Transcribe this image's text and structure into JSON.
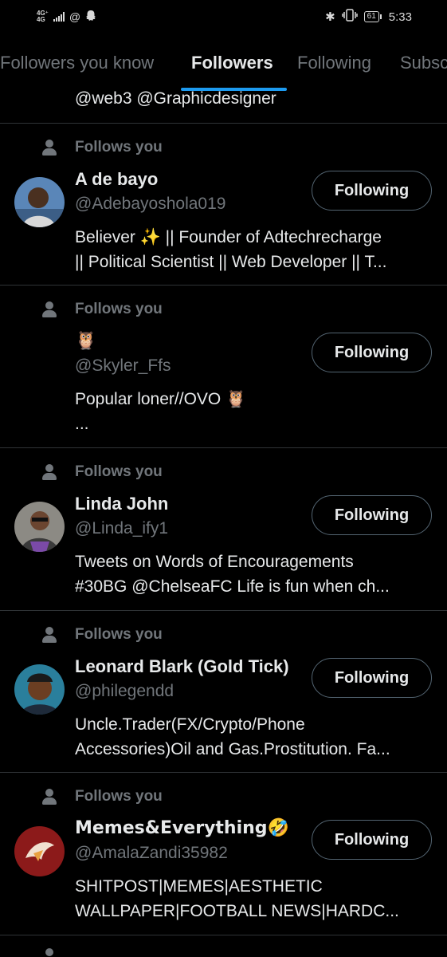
{
  "status_bar": {
    "network": "4G⁺",
    "network2": "4G",
    "at_icon": "@",
    "snap_icon": "ghost-icon",
    "bluetooth": "✱",
    "battery_level": "61",
    "time": "5:33"
  },
  "tabs": [
    {
      "label": "Followers you know"
    },
    {
      "label": "Followers"
    },
    {
      "label": "Following"
    },
    {
      "label": "Subsc"
    }
  ],
  "active_tab": "Followers",
  "partial_bio": "@web3 @Graphicdesigner",
  "users": [
    {
      "follows_you": "Follows you",
      "name": "A de bayo",
      "handle": "@Adebayoshola019",
      "button": "Following",
      "bio": "Believer ✨ || Founder of Adtechrecharge\n|| Political Scientist || Web Developer || T...",
      "avatar_color": "#5a86b8"
    },
    {
      "follows_you": "Follows you",
      "name": "🦉",
      "handle": "@Skyler_Ffs",
      "button": "Following",
      "bio": "Popular loner//OVO 🦉\n...",
      "avatar_color": ""
    },
    {
      "follows_you": "Follows you",
      "name": "Linda John",
      "handle": "@Linda_ify1",
      "button": "Following",
      "bio": "Tweets on Words of Encouragements\n#30BG @ChelseaFC Life is fun when ch...",
      "avatar_color": "#8c8a84"
    },
    {
      "follows_you": "Follows you",
      "name": "Leonard Blark (Gold Tick)",
      "handle": "@philegendd",
      "button": "Following",
      "bio": "Uncle.Trader(FX/Crypto/Phone\nAccessories)Oil and Gas.Prostitution. Fa...",
      "avatar_color": "#2a7f9c"
    },
    {
      "follows_you": "Follows you",
      "name": "Memes&Everything🤣",
      "handle": "@AmalaZandi35982",
      "button": "Following",
      "bio": "SHITPOST|MEMES|AESTHETIC\nWALLPAPER|FOOTBALL NEWS|HARDC...",
      "avatar_color": "#8c1a1a"
    }
  ],
  "colors": {
    "background": "#000000",
    "text_primary": "#e7e9ea",
    "text_secondary": "#71767b",
    "accent": "#1d9bf0",
    "divider": "#2f3336"
  }
}
